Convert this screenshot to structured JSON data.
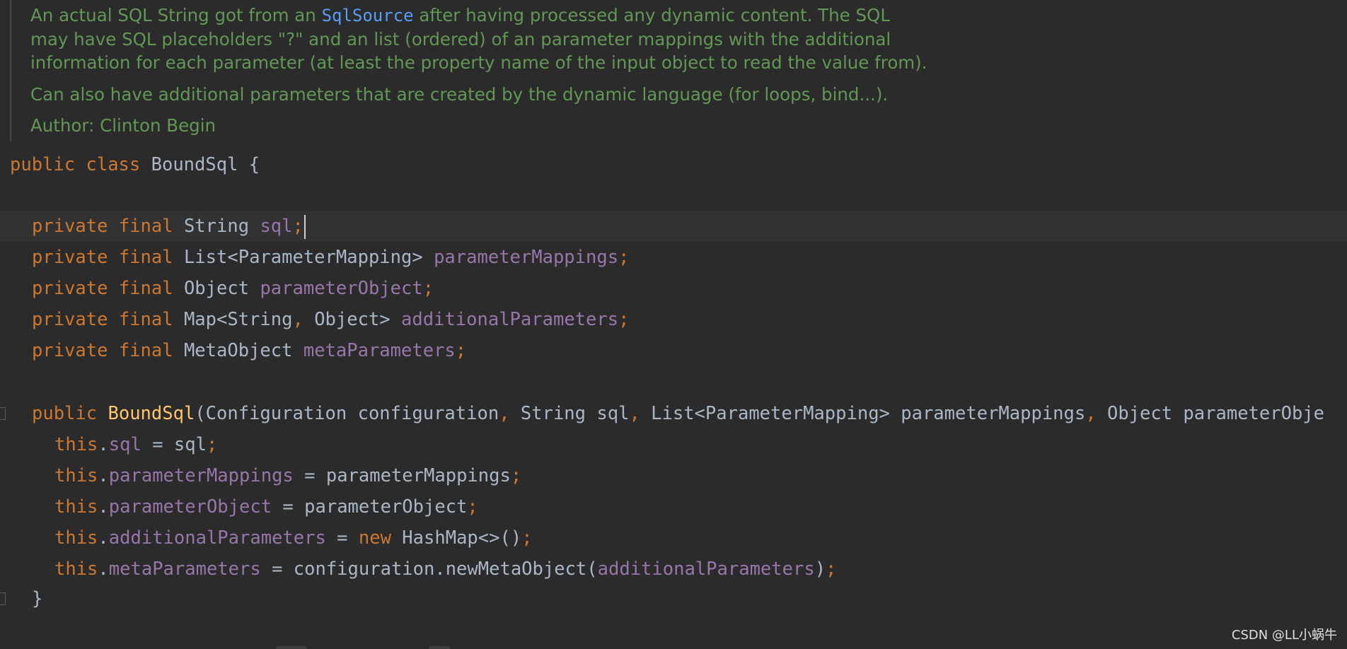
{
  "javadoc": {
    "line1_before": "An actual SQL String got from an ",
    "line1_link": "SqlSource",
    "line1_after": " after having processed any dynamic content. The SQL",
    "line2": "may have SQL placeholders \"?\" and an list (ordered) of an parameter mappings with the additional",
    "line3": "information for each parameter (at least the property name of the input object to read the value from).",
    "line4": "Can also have additional parameters that are created by the dynamic language (for loops, bind...).",
    "line5": "Author: Clinton Begin"
  },
  "code": {
    "kw_public": "public",
    "kw_class": "class",
    "kw_private": "private",
    "kw_final": "final",
    "kw_this": "this",
    "kw_new": "new",
    "class_name": "BoundSql",
    "open_brace": " {",
    "close_brace": "}",
    "fields": [
      {
        "type": "String",
        "name": "sql"
      },
      {
        "type": "List<ParameterMapping>",
        "name": "parameterMappings"
      },
      {
        "type": "Object",
        "name": "parameterObject"
      },
      {
        "type_a": "Map<String",
        "type_b": " Object>",
        "name": "additionalParameters"
      },
      {
        "type": "MetaObject",
        "name": "metaParameters"
      }
    ],
    "ctor": {
      "name": "BoundSql",
      "p1": "(Configuration configuration",
      "p2": " String sql",
      "p3": " List<ParameterMapping> parameterMappings",
      "p4": " Object parameterObje"
    },
    "body": {
      "l1_field": "sql",
      "l1_rest": " = sql",
      "l2_field": "parameterMappings",
      "l2_rest": " = parameterMappings",
      "l3_field": "parameterObject",
      "l3_rest": " = parameterObject",
      "l4_field": "additionalParameters",
      "l4_mid": " = ",
      "l4_rest": " HashMap<>()",
      "l5_field": "metaParameters",
      "l5_mid": " = configuration.newMetaObject(",
      "l5_arg": "additionalParameters",
      "l5_end": ")"
    },
    "dot": ".",
    "semicolon": ";",
    "comma": ","
  },
  "watermark": "CSDN @LL小蜗牛",
  "colors": {
    "background": "#2b2b2b",
    "keyword": "#cc7832",
    "field": "#9876aa",
    "method": "#ffc66d",
    "text": "#a9b7c6",
    "doc": "#629755",
    "link": "#589df6"
  }
}
